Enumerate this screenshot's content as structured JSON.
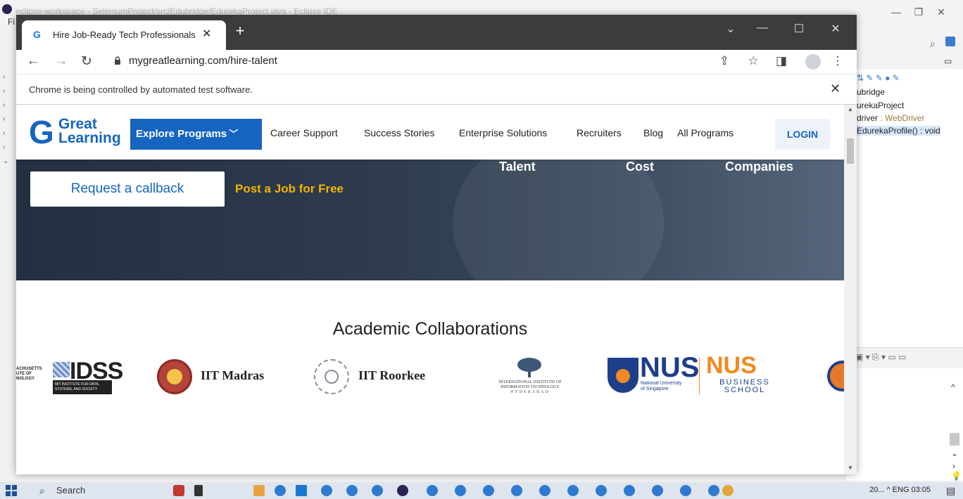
{
  "eclipse": {
    "title": "eclipse-workspace - SeleniumProject/src/Edubridge/EdurekaProject.java - Eclipse IDE",
    "menu_first": "Fi",
    "outline_items": [
      "ubridge",
      "urekaProject",
      "driver",
      " : WebDriver",
      "EdurekaProfile() : void"
    ]
  },
  "chrome": {
    "tab_title": "Hire Job-Ready Tech Professionals",
    "favicon": "G",
    "tab_close": "✕",
    "new_tab": "+",
    "url": "mygreatlearning.com/hire-talent",
    "infobar_text": "Chrome is being controlled by automated test software.",
    "infobar_close": "✕"
  },
  "site": {
    "logo_g": "G",
    "logo_word1": "Great",
    "logo_word2": "Learning",
    "explore": "Explore Programs",
    "nav": [
      "Career Support",
      "Success Stories",
      "Enterprise Solutions",
      "Recruiters",
      "Blog",
      "All Programs"
    ],
    "login": "LOGIN",
    "hero_stats": [
      "Talent",
      "Cost",
      "Companies"
    ],
    "callback": "Request a callback",
    "post_job": "Post a Job for Free",
    "academic_title": "Academic Collaborations",
    "logos": {
      "mit_side": [
        "ACHUSETTS",
        "UTE OF",
        "NOLOGY"
      ],
      "idss": "IDSS",
      "idss_sub": "MIT INSTITUTE FOR DATA, SYSTEMS, AND SOCIETY",
      "iit_madras": "IIT Madras",
      "iit_roorkee": "IIT Roorkee",
      "iiit_line1": "INTERNATIONAL INSTITUTE OF",
      "iiit_line2": "INFORMATION TECHNOLOGY",
      "iiit_line3": "HYDERABAD",
      "nus": "NUS",
      "nus_sub1": "National University",
      "nus_sub2": "of Singapore",
      "nus_bs": "NUS",
      "nus_bs_sub1": "BUSINESS",
      "nus_bs_sub2": "SCHOOL"
    }
  },
  "taskbar": {
    "search": "Search",
    "tray": "20...  ^  ENG  03:05"
  },
  "colors": {
    "brand": "#1565c0",
    "accent": "#f5b301"
  }
}
